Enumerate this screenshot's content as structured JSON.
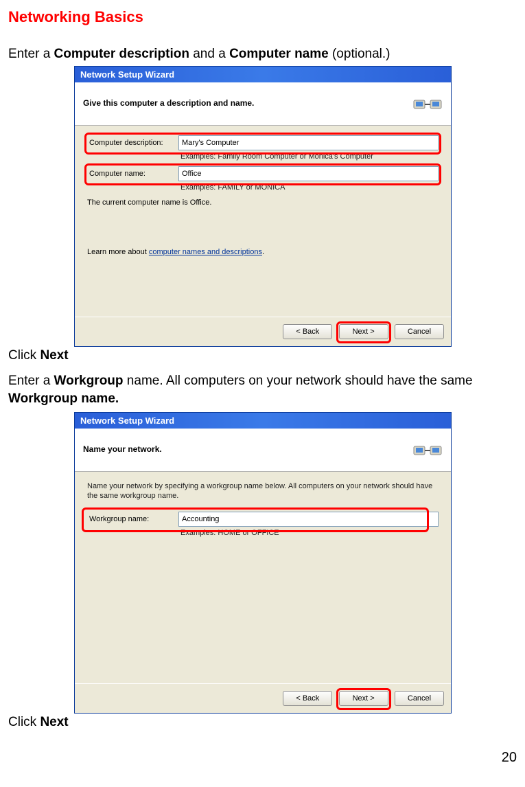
{
  "heading": "Networking Basics",
  "step1": {
    "pre": "Enter a ",
    "bold1": "Computer description",
    "mid": " and a ",
    "bold2": "Computer name",
    "post": " (optional.)"
  },
  "dialog1": {
    "title": "Network Setup Wizard",
    "header": "Give this computer a description and name.",
    "label_desc": "Computer description:",
    "value_desc": "Mary's Computer",
    "hint_desc": "Examples: Family Room Computer or Monica's Computer",
    "label_name": "Computer name:",
    "value_name": "Office",
    "hint_name": "Examples: FAMILY or MONICA",
    "current": "The current computer name is Office.",
    "learn_pre": "Learn more about ",
    "learn_link": "computer names and descriptions",
    "btn_back": "< Back",
    "btn_next": "Next >",
    "btn_cancel": "Cancel"
  },
  "click1": {
    "pre": "Click ",
    "bold": "Next"
  },
  "step2": {
    "pre": "Enter a ",
    "bold1": "Workgroup",
    "mid": " name.  All computers on your network should have the same ",
    "bold2": "Workgroup name."
  },
  "dialog2": {
    "title": "Network Setup Wizard",
    "header": "Name your network.",
    "intro": "Name your network by specifying a workgroup name below. All computers on your network should have the same workgroup name.",
    "label_wg": "Workgroup name:",
    "value_wg": "Accounting",
    "hint_wg": "Examples: HOME or OFFICE",
    "btn_back": "< Back",
    "btn_next": "Next >",
    "btn_cancel": "Cancel"
  },
  "click2": {
    "pre": "Click ",
    "bold": "Next"
  },
  "page_number": "20"
}
